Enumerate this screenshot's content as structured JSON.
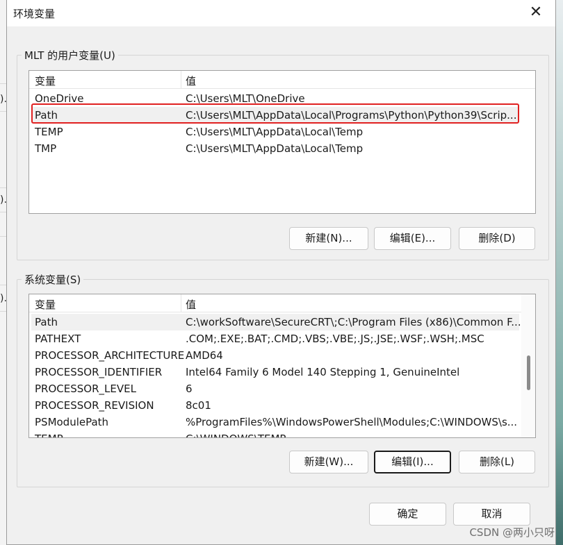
{
  "window": {
    "title": "环境变量",
    "close_symbol": "✕"
  },
  "user_vars": {
    "group_label": "MLT 的用户变量(U)",
    "columns": [
      "变量",
      "值"
    ],
    "rows": [
      {
        "name": "OneDrive",
        "value": "C:\\Users\\MLT\\OneDrive"
      },
      {
        "name": "Path",
        "value": "C:\\Users\\MLT\\AppData\\Local\\Programs\\Python\\Python39\\Scrip..."
      },
      {
        "name": "TEMP",
        "value": "C:\\Users\\MLT\\AppData\\Local\\Temp"
      },
      {
        "name": "TMP",
        "value": "C:\\Users\\MLT\\AppData\\Local\\Temp"
      }
    ],
    "highlighted_row": "Path",
    "buttons": {
      "new": "新建(N)...",
      "edit": "编辑(E)...",
      "delete": "删除(D)"
    }
  },
  "system_vars": {
    "group_label": "系统变量(S)",
    "columns": [
      "变量",
      "值"
    ],
    "rows": [
      {
        "name": "Path",
        "value": "C:\\workSoftware\\SecureCRT\\;C:\\Program Files (x86)\\Common F..."
      },
      {
        "name": "PATHEXT",
        "value": ".COM;.EXE;.BAT;.CMD;.VBS;.VBE;.JS;.JSE;.WSF;.WSH;.MSC"
      },
      {
        "name": "PROCESSOR_ARCHITECTURE",
        "value": "AMD64"
      },
      {
        "name": "PROCESSOR_IDENTIFIER",
        "value": "Intel64 Family 6 Model 140 Stepping 1, GenuineIntel"
      },
      {
        "name": "PROCESSOR_LEVEL",
        "value": "6"
      },
      {
        "name": "PROCESSOR_REVISION",
        "value": "8c01"
      },
      {
        "name": "PSModulePath",
        "value": "%ProgramFiles%\\WindowsPowerShell\\Modules;C:\\WINDOWS\\s..."
      },
      {
        "name": "TEMP",
        "value": "C:\\WINDOWS\\TEMP"
      }
    ],
    "selected_row": "Path",
    "buttons": {
      "new": "新建(W)...",
      "edit": "编辑(I)...",
      "delete": "删除(L)"
    }
  },
  "footer": {
    "ok": "确定",
    "cancel": "取消"
  },
  "watermark": "CSDN @两小只呀",
  "background": {
    "fragments": [
      ").",
      ").",
      ")."
    ]
  },
  "colors": {
    "highlight_border": "#e02020",
    "dialog_bg": "#f0f0f0"
  }
}
